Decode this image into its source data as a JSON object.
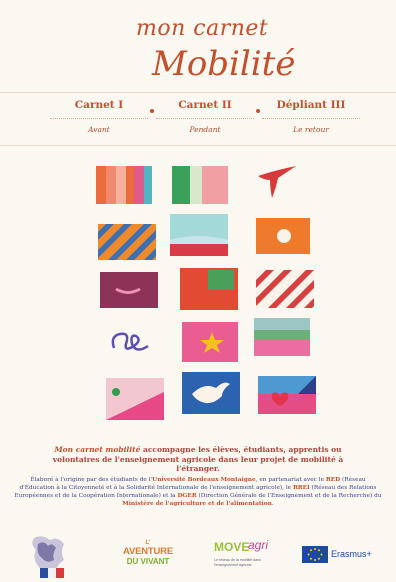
{
  "header": {
    "title_line1": "mon carnet",
    "title_line2": "Mobilité"
  },
  "nav": {
    "items": [
      {
        "label": "Carnet I",
        "sub": "Avant"
      },
      {
        "label": "Carnet II",
        "sub": "Pendant"
      },
      {
        "label": "Dépliant III",
        "sub": "Le retour"
      }
    ]
  },
  "intro": {
    "highlight": "Mon carnet mobilité",
    "text": " accompagne les élèves, étudiants, apprentis ou volontaires de l'enseignement agricole dans leur projet de mobilité à l'étranger."
  },
  "credits": {
    "p1": "Élaboré à l'origine par des étudiants de l'",
    "uni": "Université Bordeaux Montaigne",
    "p2": ", en partenariat avec le ",
    "rez": "RED",
    "p3": " (Réseau d'Éducation à la Citoyenneté et à la Solidarité Internationale de l'enseignement agricole), le ",
    "rrei": "RREI",
    "p4": " (Réseau des Relations Européennes et de la Coopération Internationale) et la ",
    "dger": "DGER",
    "p5": " (Direction Générale de l'Enseignement et de la Recherche) du ",
    "min": "Ministère de l'agriculture et de l'alimentation",
    "p6": "."
  },
  "footer": {
    "aventure_l1": "L'",
    "aventure_l2": "AVENTURE",
    "aventure_l3": "DU VIVANT",
    "move": "MOVE",
    "agri": "agri",
    "move_sub": "Le réseau de la mobilité dans l'enseignement agricole",
    "erasmus": "Erasmus+"
  },
  "colors": {
    "accent": "#c4502b",
    "navy": "#3a3f8a",
    "background": "#fbf8f2"
  }
}
